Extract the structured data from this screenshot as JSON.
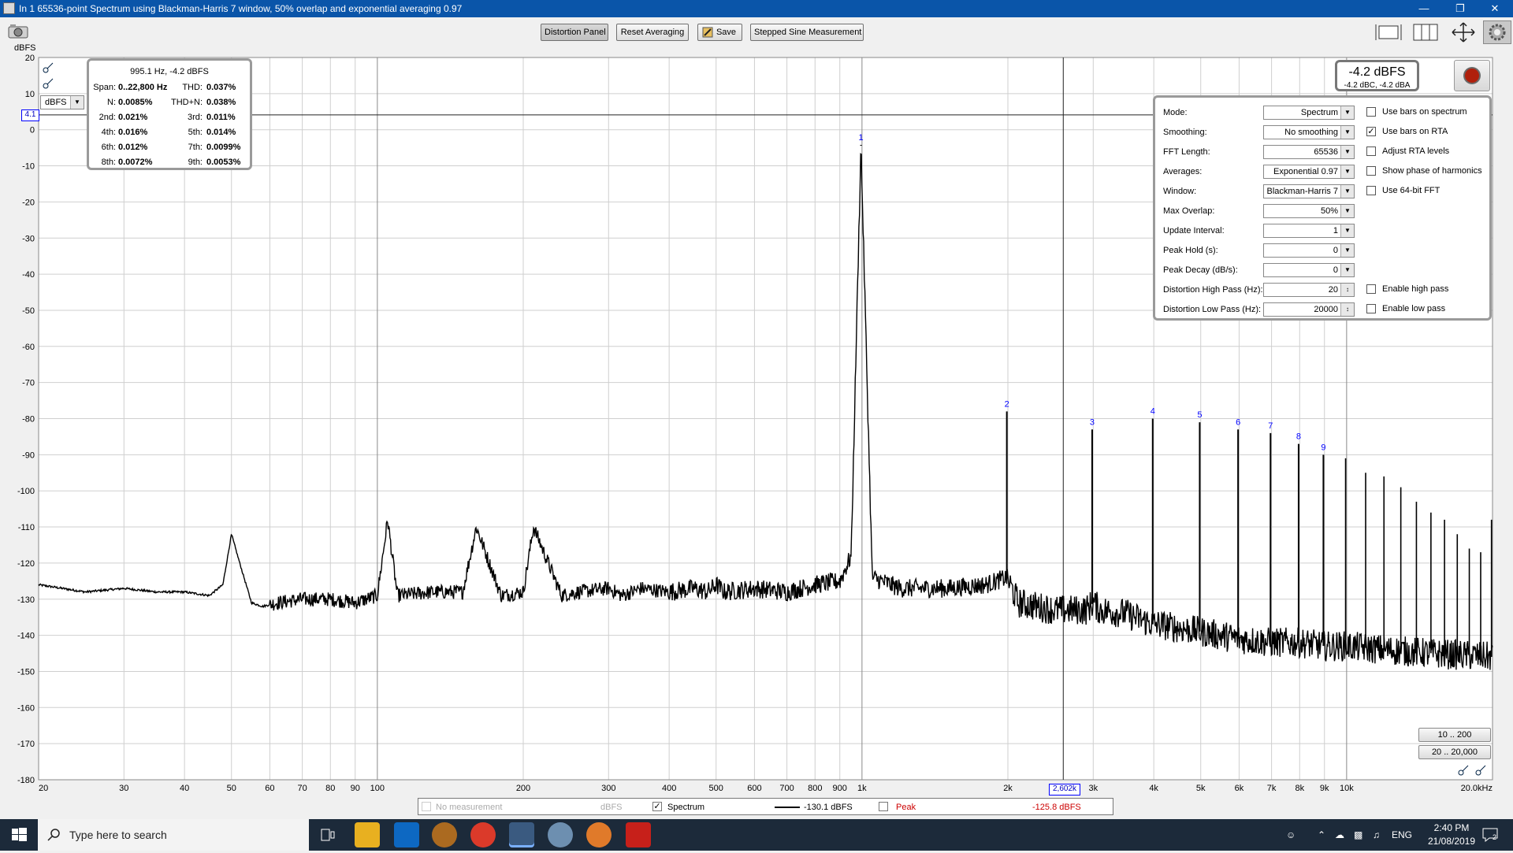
{
  "window": {
    "title": "In 1 65536-point Spectrum using Blackman-Harris 7 window, 50% overlap and exponential averaging 0.97"
  },
  "toolbar": {
    "distortion_panel": "Distortion Panel",
    "reset_averaging": "Reset Averaging",
    "save": "Save",
    "stepped_sine": "Stepped Sine Measurement"
  },
  "distortion_panel": {
    "header": "995.1 Hz, -4.2 dBFS",
    "rows": [
      {
        "l1": "Span:",
        "v1": "0..22,800 Hz",
        "l2": "THD:",
        "v2": "0.037%"
      },
      {
        "l1": "N:",
        "v1": "0.0085%",
        "l2": "THD+N:",
        "v2": "0.038%"
      },
      {
        "l1": "2nd:",
        "v1": "0.021%",
        "l2": "3rd:",
        "v2": "0.011%"
      },
      {
        "l1": "4th:",
        "v1": "0.016%",
        "l2": "5th:",
        "v2": "0.014%"
      },
      {
        "l1": "6th:",
        "v1": "0.012%",
        "l2": "7th:",
        "v2": "0.0099%"
      },
      {
        "l1": "8th:",
        "v1": "0.0072%",
        "l2": "9th:",
        "v2": "0.0053%"
      }
    ]
  },
  "level_meter": {
    "main": "-4.2 dBFS",
    "sub": "-4.2 dBC, -4.2 dBA"
  },
  "controls": {
    "rows": [
      {
        "label": "Mode:",
        "value": "Spectrum",
        "type": "combo"
      },
      {
        "label": "Smoothing:",
        "value": "No  smoothing",
        "type": "combo"
      },
      {
        "label": "FFT Length:",
        "value": "65536",
        "type": "combo"
      },
      {
        "label": "Averages:",
        "value": "Exponential 0.97",
        "type": "combo"
      },
      {
        "label": "Window:",
        "value": "Blackman-Harris 7",
        "type": "combo"
      },
      {
        "label": "Max Overlap:",
        "value": "50%",
        "type": "combo"
      },
      {
        "label": "Update Interval:",
        "value": "1",
        "type": "combo"
      },
      {
        "label": "Peak Hold (s):",
        "value": "0",
        "type": "combo"
      },
      {
        "label": "Peak Decay (dB/s):",
        "value": "0",
        "type": "combo"
      },
      {
        "label": "Distortion High Pass (Hz):",
        "value": "20",
        "type": "spin"
      },
      {
        "label": "Distortion Low Pass (Hz):",
        "value": "20000",
        "type": "spin"
      }
    ],
    "checks": [
      {
        "label": "Use bars on spectrum",
        "checked": false
      },
      {
        "label": "Use bars on RTA",
        "checked": true
      },
      {
        "label": "Adjust RTA levels",
        "checked": false
      },
      {
        "label": "Show phase of harmonics",
        "checked": false
      },
      {
        "label": "Use 64-bit FFT",
        "checked": false
      },
      {
        "label": "Enable high pass",
        "checked": false,
        "row": 9
      },
      {
        "label": "Enable low pass",
        "checked": false,
        "row": 10
      }
    ]
  },
  "range_buttons": [
    "10 .. 200",
    "20 .. 20,000"
  ],
  "unit_combo": "dBFS",
  "cursor": {
    "y_label": "4.1",
    "x_label": "2,602k"
  },
  "legend": {
    "no_measurement": "No measurement",
    "no_measurement_unit": "dBFS",
    "spectrum": "Spectrum",
    "spectrum_value": "-130.1 dBFS",
    "peak": "Peak",
    "peak_value": "-125.8 dBFS"
  },
  "taskbar": {
    "search_placeholder": "Type here to search",
    "lang": "ENG",
    "time": "2:40 PM",
    "date": "21/08/2019",
    "notif_count": "2"
  },
  "colors": {
    "title_bar": "#0a55a9",
    "trace": "#000000",
    "harmonic_label": "#0000ff",
    "peak_text": "#cc0000",
    "taskbar": "#1c2a3a"
  },
  "chart_data": {
    "type": "line",
    "ylabel": "dBFS",
    "ylim": [
      -180,
      20
    ],
    "xlim": [
      20,
      20000
    ],
    "xscale": "log",
    "grid": true,
    "y_ticks": [
      20,
      10,
      0,
      -10,
      -20,
      -30,
      -40,
      -50,
      -60,
      -70,
      -80,
      -90,
      -100,
      -110,
      -120,
      -130,
      -140,
      -150,
      -160,
      -170,
      -180
    ],
    "x_ticks": [
      {
        "v": 20,
        "label": "20"
      },
      {
        "v": 30,
        "label": "30"
      },
      {
        "v": 40,
        "label": "40"
      },
      {
        "v": 50,
        "label": "50"
      },
      {
        "v": 60,
        "label": "60"
      },
      {
        "v": 70,
        "label": "70"
      },
      {
        "v": 80,
        "label": "80"
      },
      {
        "v": 90,
        "label": "90"
      },
      {
        "v": 100,
        "label": "100"
      },
      {
        "v": 200,
        "label": "200"
      },
      {
        "v": 300,
        "label": "300"
      },
      {
        "v": 400,
        "label": "400"
      },
      {
        "v": 500,
        "label": "500"
      },
      {
        "v": 600,
        "label": "600"
      },
      {
        "v": 700,
        "label": "700"
      },
      {
        "v": 800,
        "label": "800"
      },
      {
        "v": 900,
        "label": "900"
      },
      {
        "v": 1000,
        "label": "1k"
      },
      {
        "v": 2000,
        "label": "2k"
      },
      {
        "v": 3000,
        "label": "3k"
      },
      {
        "v": 4000,
        "label": "4k"
      },
      {
        "v": 5000,
        "label": "5k"
      },
      {
        "v": 6000,
        "label": "6k"
      },
      {
        "v": 7000,
        "label": "7k"
      },
      {
        "v": 8000,
        "label": "8k"
      },
      {
        "v": 9000,
        "label": "9k"
      },
      {
        "v": 10000,
        "label": "10k"
      },
      {
        "v": 20000,
        "label": "20.0kHz"
      }
    ],
    "series": [
      {
        "name": "Spectrum",
        "x": [
          20,
          25,
          30,
          35,
          40,
          45,
          48,
          50,
          52,
          55,
          58,
          62,
          70,
          80,
          90,
          100,
          105,
          110,
          130,
          150,
          160,
          180,
          200,
          210,
          240,
          260,
          300,
          320,
          350,
          400,
          450,
          480,
          500,
          520,
          600,
          700,
          800,
          900,
          950,
          995,
          1050,
          1200,
          1500,
          1800,
          1990,
          2100,
          2500,
          2900,
          3000,
          3100,
          3500,
          3990,
          4100,
          5000,
          6000,
          7000,
          8000,
          9000,
          10000,
          12000,
          15000,
          20000
        ],
        "y": [
          -126,
          -128,
          -127,
          -128,
          -128,
          -129,
          -126,
          -112,
          -120,
          -131,
          -132,
          -131,
          -130,
          -130,
          -131,
          -129,
          -108,
          -129,
          -128,
          -128,
          -110,
          -129,
          -128,
          -110,
          -129,
          -128,
          -127,
          -129,
          -127,
          -128,
          -127,
          -128,
          -126,
          -128,
          -127,
          -128,
          -126,
          -125,
          -118,
          -4.2,
          -124,
          -127,
          -127,
          -126,
          -124,
          -131,
          -133,
          -133,
          -131,
          -133,
          -134,
          -137,
          -137,
          -139,
          -141,
          -142,
          -142,
          -143,
          -143,
          -144,
          -145,
          -146
        ]
      }
    ],
    "harmonics": [
      {
        "n": "1",
        "f": 995.1,
        "db": -4.2
      },
      {
        "n": "2",
        "f": 1990,
        "db": -78
      },
      {
        "n": "3",
        "f": 2985,
        "db": -83
      },
      {
        "n": "4",
        "f": 3980,
        "db": -80
      },
      {
        "n": "5",
        "f": 4976,
        "db": -81
      },
      {
        "n": "6",
        "f": 5971,
        "db": -83
      },
      {
        "n": "7",
        "f": 6966,
        "db": -84
      },
      {
        "n": "8",
        "f": 7961,
        "db": -87
      },
      {
        "n": "9",
        "f": 8956,
        "db": -90
      }
    ],
    "higher_harmonics": [
      {
        "f": 9951,
        "db": -91
      },
      {
        "f": 10946,
        "db": -95
      },
      {
        "f": 11941,
        "db": -96
      },
      {
        "f": 12937,
        "db": -99
      },
      {
        "f": 13932,
        "db": -103
      },
      {
        "f": 14927,
        "db": -106
      },
      {
        "f": 15922,
        "db": -108
      },
      {
        "f": 16917,
        "db": -112
      },
      {
        "f": 17912,
        "db": -116
      },
      {
        "f": 18907,
        "db": -117
      },
      {
        "f": 19902,
        "db": -108
      }
    ]
  }
}
